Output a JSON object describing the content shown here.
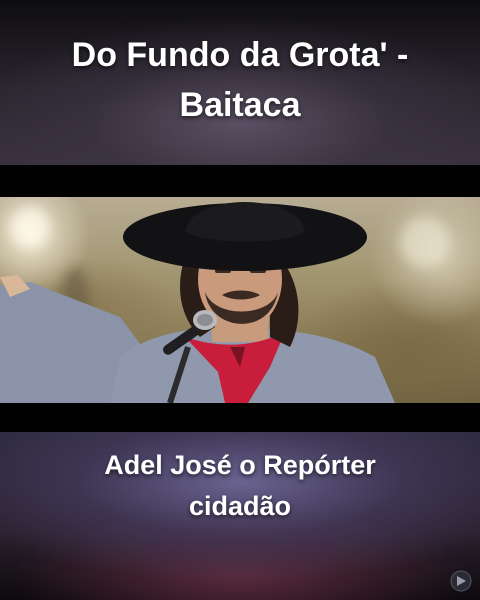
{
  "title": {
    "line1": "Do Fundo da Grota' -",
    "line2": "Baitaca"
  },
  "caption": {
    "line1": "Adel José o Repórter",
    "line2": "cidadão"
  },
  "video": {
    "subject": "man in black wide-brim hat singing into microphone, red neckerchief, grey shirt",
    "icons": [
      "microphone-icon"
    ]
  },
  "colors": {
    "text": "#ffffff",
    "band": "#020203",
    "neckerchief": "#c81e3c",
    "hat": "#121214"
  }
}
